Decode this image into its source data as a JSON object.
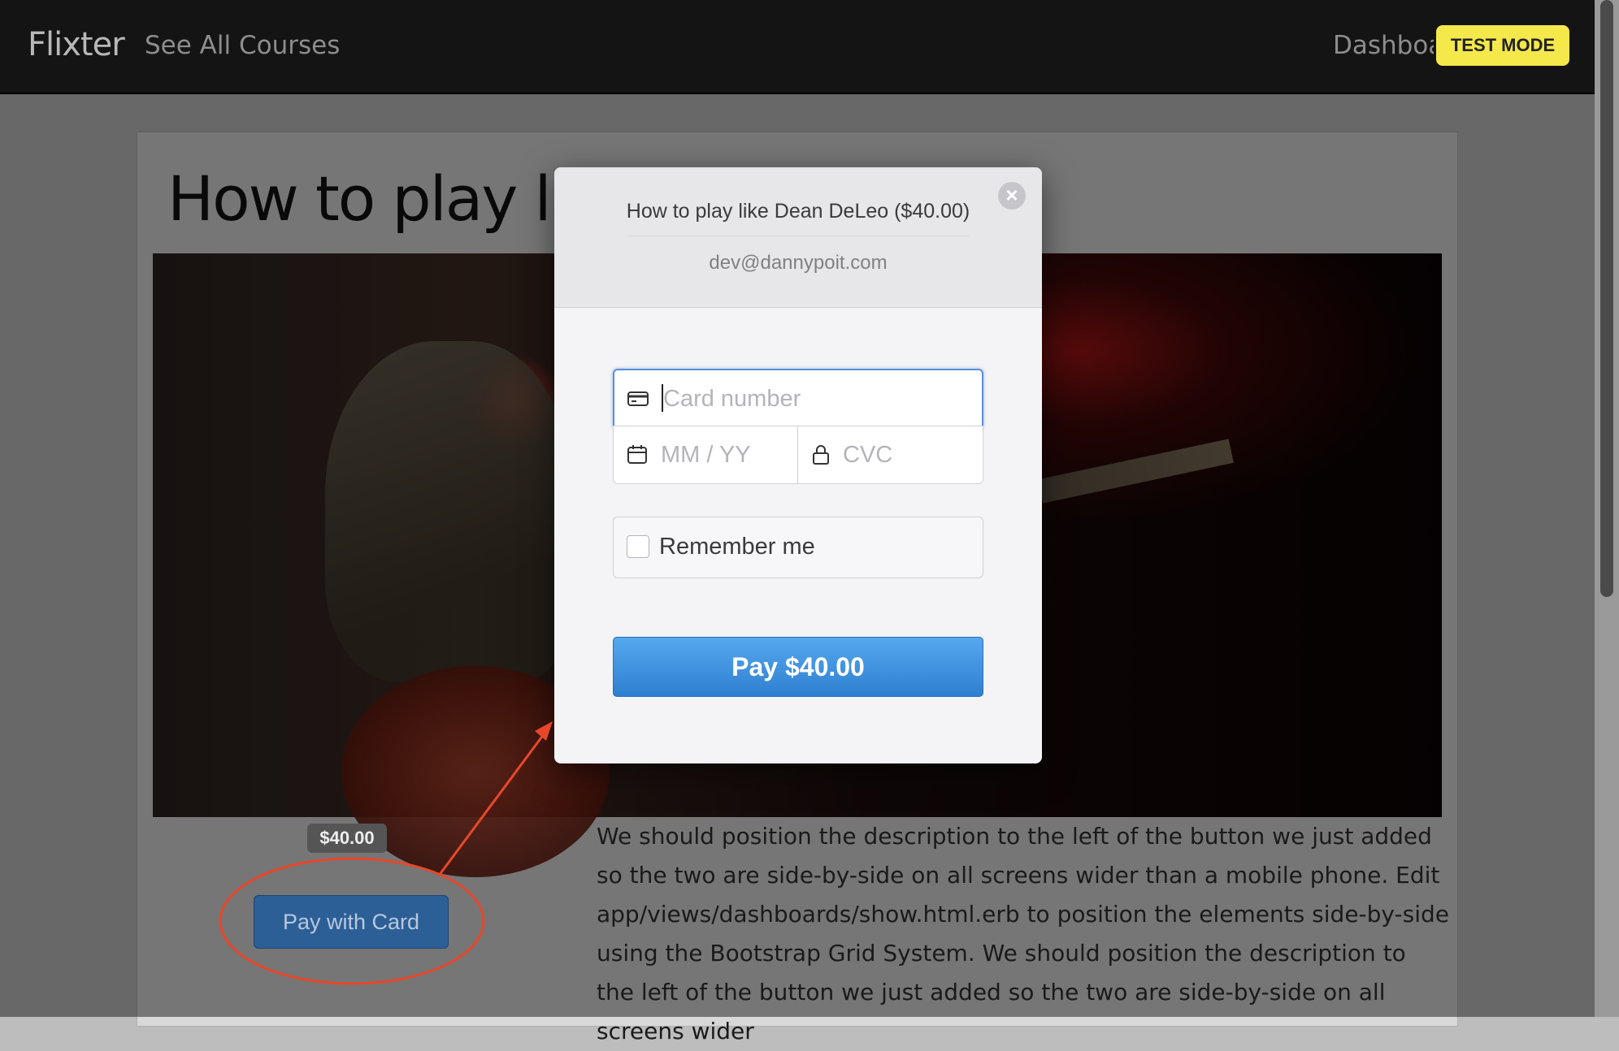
{
  "navbar": {
    "brand": "Flixter",
    "see_all_courses": "See All Courses",
    "dashboard": "Dashboard",
    "test_mode": "TEST MODE"
  },
  "course": {
    "title": "How to play like Dean DeLeo",
    "price_badge": "$40.00",
    "pay_with_card": "Pay with Card",
    "description": "We should position the description to the left of the button we just added so the two are side-by-side on all screens wider than a mobile phone. Edit app/views/dashboards/show.html.erb to position the elements side-by-side using the Bootstrap Grid System. We should position the description to the left of the button we just added so the two are side-by-side on all screens wider"
  },
  "checkout": {
    "title": "How to play like Dean DeLeo ($40.00)",
    "email": "dev@dannypoit.com",
    "close_icon": "close-icon",
    "card_number_placeholder": "Card number",
    "expiry_placeholder": "MM / YY",
    "cvc_placeholder": "CVC",
    "remember_me": "Remember me",
    "remember_checked": false,
    "pay_label": "Pay $40.00"
  },
  "icons": {
    "card": "credit-card-icon",
    "calendar": "calendar-icon",
    "lock": "lock-icon"
  },
  "colors": {
    "test_mode_bg": "#f5e84a",
    "pay_button": "#3d8fe0",
    "annotation": "#e8472a",
    "focus_border": "#5b8fdb"
  }
}
